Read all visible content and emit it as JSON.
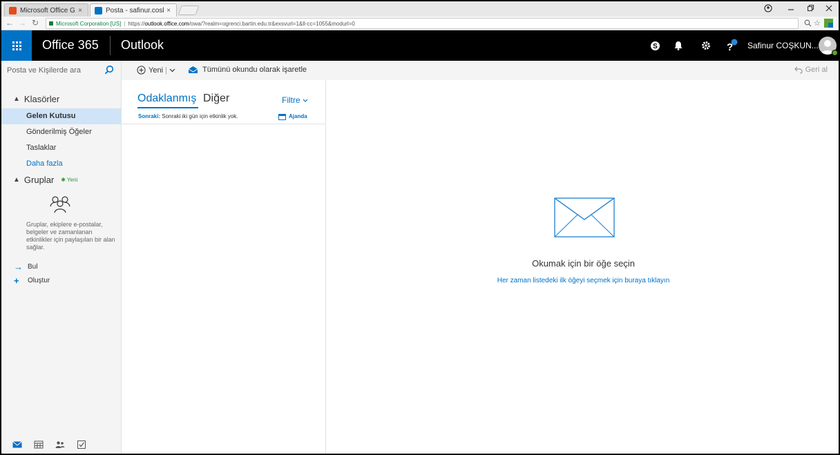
{
  "browser": {
    "tabs": [
      {
        "label": "Microsoft Office Giriş",
        "close": "×"
      },
      {
        "label": "Posta - safinur.coskunsu",
        "close": "×"
      }
    ],
    "url": {
      "organization": "Microsoft Corporation [US]",
      "prefix": "https://",
      "host": "outlook.office.com",
      "path": "/owa/?realm=ogrenci.bartin.edu.tr&exsvurl=1&ll-cc=1055&modurl=0"
    },
    "colors": {
      "secure": "#0b8043"
    }
  },
  "header": {
    "brand": "Office 365",
    "app": "Outlook",
    "user": "Safinur COŞKUN...",
    "colors": {
      "accent": "#0072c6",
      "bar": "#000000"
    }
  },
  "commands": {
    "search_placeholder": "Posta ve Kişilerde ara",
    "new": "Yeni",
    "mark_all_read": "Tümünü okundu olarak işaretle",
    "undo": "Geri al"
  },
  "nav": {
    "folders_header": "Klasörler",
    "folders": [
      "Gelen Kutusu",
      "Gönderilmiş Öğeler",
      "Taslaklar"
    ],
    "more": "Daha fazla",
    "groups_header": "Gruplar",
    "groups_new": "Yeni",
    "groups_desc": "Gruplar, ekiplere e-postalar, belgeler ve zamanlanan etkinlikler için paylaşılan bir alan sağlar.",
    "find": "Bul",
    "create": "Oluştur"
  },
  "list": {
    "focused": "Odaklanmış",
    "other": "Diğer",
    "filter": "Filtre",
    "next_label": "Sonraki:",
    "next_text": "Sonraki iki gün için etkinlik yok.",
    "agenda": "Ajanda"
  },
  "reading": {
    "title": "Okumak için bir öğe seçin",
    "link": "Her zaman listedeki ilk öğeyi seçmek için buraya tıklayın"
  }
}
